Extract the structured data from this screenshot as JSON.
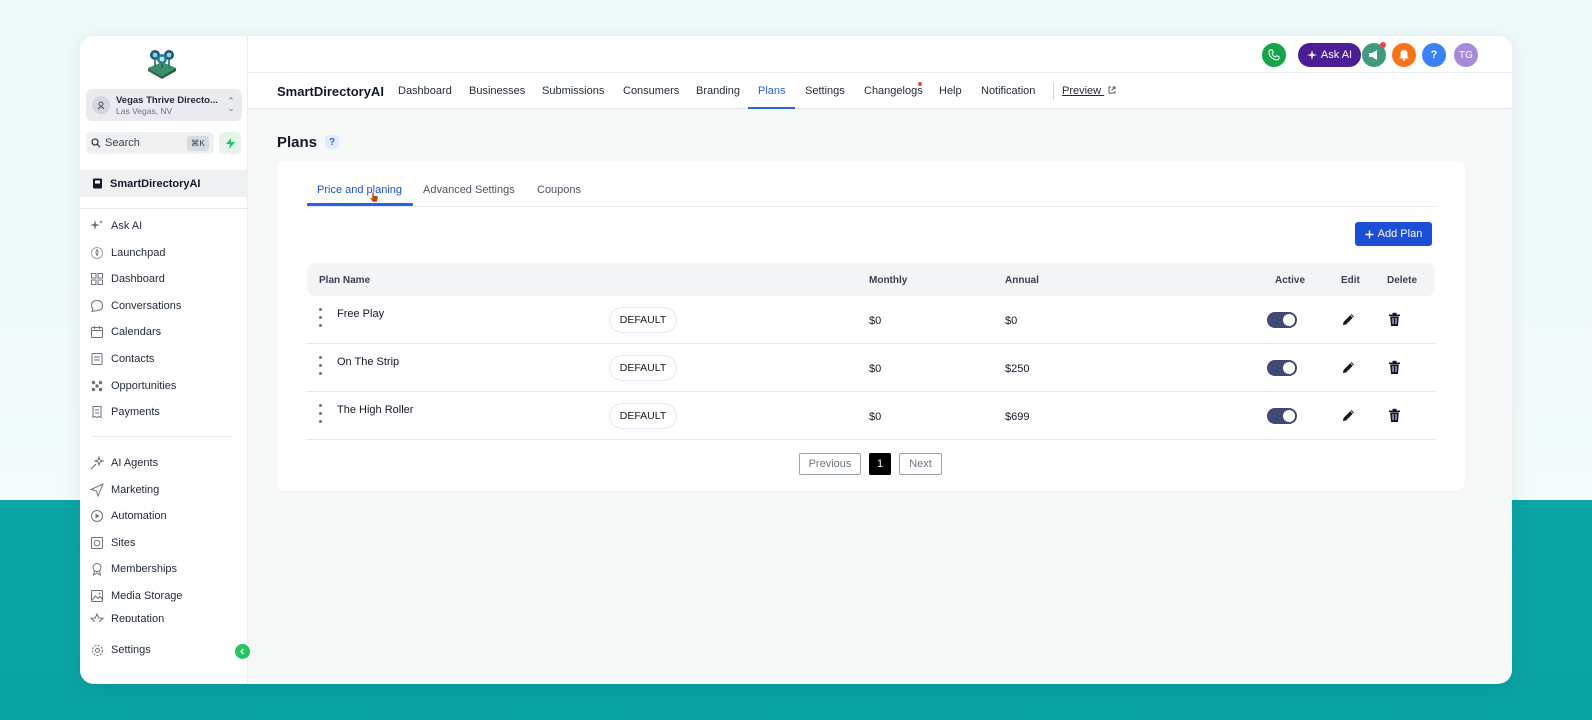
{
  "sidebar": {
    "location": {
      "name": "Vegas Thrive Directo...",
      "sub": "Las Vegas, NV"
    },
    "search": {
      "label": "Search",
      "shortcut": "⌘K"
    },
    "brand_item": "SmartDirectoryAI",
    "items_group1": [
      {
        "label": "Ask AI",
        "icon": "sparkle-icon"
      },
      {
        "label": "Launchpad",
        "icon": "rocket-icon"
      },
      {
        "label": "Dashboard",
        "icon": "grid-icon"
      },
      {
        "label": "Conversations",
        "icon": "chat-bubble-icon"
      },
      {
        "label": "Calendars",
        "icon": "calendar-icon"
      },
      {
        "label": "Contacts",
        "icon": "contacts-icon"
      },
      {
        "label": "Opportunities",
        "icon": "opportunities-icon"
      },
      {
        "label": "Payments",
        "icon": "receipt-icon"
      }
    ],
    "items_group2": [
      {
        "label": "AI Agents",
        "icon": "ai-agents-icon"
      },
      {
        "label": "Marketing",
        "icon": "send-icon"
      },
      {
        "label": "Automation",
        "icon": "automation-icon"
      },
      {
        "label": "Sites",
        "icon": "globe-icon"
      },
      {
        "label": "Memberships",
        "icon": "award-icon"
      },
      {
        "label": "Media Storage",
        "icon": "image-icon"
      },
      {
        "label": "Reputation",
        "icon": "star-icon"
      }
    ],
    "settings": "Settings"
  },
  "topbar": {
    "ask_ai": "Ask AI",
    "avatar_initials": "TG",
    "help": "?"
  },
  "subnav": {
    "brand": "SmartDirectoryAI",
    "items": [
      "Dashboard",
      "Businesses",
      "Submissions",
      "Consumers",
      "Branding",
      "Plans",
      "Settings",
      "Changelogs",
      "Help",
      "Notification"
    ],
    "active": "Plans",
    "preview": "Preview"
  },
  "page": {
    "title": "Plans",
    "help": "?",
    "tabs": [
      "Price and planing",
      "Advanced Settings",
      "Coupons"
    ],
    "active_tab": "Price and planing",
    "add_plan": "Add Plan",
    "table": {
      "headers": {
        "name": "Plan Name",
        "monthly": "Monthly",
        "annual": "Annual",
        "active": "Active",
        "edit": "Edit",
        "delete": "Delete"
      },
      "rows": [
        {
          "name": "Free Play",
          "badge": "DEFAULT",
          "monthly": "$0",
          "annual": "$0",
          "active": true
        },
        {
          "name": "On The Strip",
          "badge": "DEFAULT",
          "monthly": "$0",
          "annual": "$250",
          "active": true
        },
        {
          "name": "The High Roller",
          "badge": "DEFAULT",
          "monthly": "$0",
          "annual": "$699",
          "active": true
        }
      ]
    },
    "pagination": {
      "previous": "Previous",
      "current": "1",
      "next": "Next"
    }
  },
  "colors": {
    "accent": "#2563eb",
    "toggle_on": "#3f4a74",
    "ask_ai_bg": "#4c1d95"
  }
}
